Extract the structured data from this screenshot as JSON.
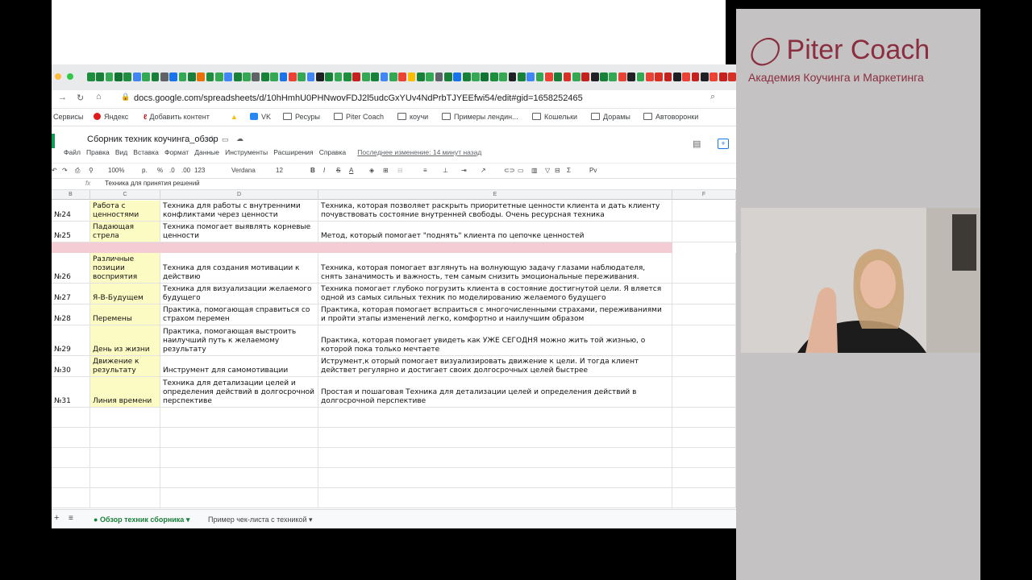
{
  "browser": {
    "url": "docs.google.com/spreadsheets/d/10hHmhU0PHNwovFDJ2l5udcGxYUv4NdPrbTJYEEfwi54/edit#gid=1658252465",
    "bookmarks": [
      "Сервисы",
      "Яндекс",
      "Добавить контент",
      "VK",
      "Ресуры",
      "Piter Coach",
      "коучи",
      "Примеры лендин...",
      "Кошельки",
      "Дорамы",
      "Автоворонки"
    ],
    "favicon_colors": [
      "#1e8e3e",
      "#188038",
      "#34a853",
      "#137333",
      "#1e8e3e",
      "#4285f4",
      "#34a853",
      "#188038",
      "#5f6368",
      "#1a73e8",
      "#34a853",
      "#188038",
      "#e8710a",
      "#1e8e3e",
      "#34a853",
      "#4285f4",
      "#188038",
      "#34a853",
      "#5f6368",
      "#188038",
      "#34a853",
      "#1a73e8",
      "#ea4335",
      "#34a853",
      "#4285f4",
      "#202124",
      "#188038",
      "#34a853",
      "#1e8e3e",
      "#c5221f",
      "#34a853",
      "#188038",
      "#4285f4",
      "#34a853",
      "#ea4335",
      "#fbbc04",
      "#188038",
      "#34a853",
      "#5f6368",
      "#188038",
      "#1a73e8",
      "#188038",
      "#34a853",
      "#137333",
      "#1e8e3e",
      "#34a853",
      "#202124",
      "#188038",
      "#4285f4",
      "#34a853",
      "#ea4335",
      "#188038",
      "#d93025",
      "#34a853",
      "#c5221f",
      "#202124",
      "#188038",
      "#34a853",
      "#ea4335",
      "#202124",
      "#34a853",
      "#ea4335",
      "#d93025",
      "#c5221f",
      "#202124",
      "#ea4335",
      "#c5221f",
      "#202124",
      "#ea4335",
      "#c5221f",
      "#d93025"
    ]
  },
  "doc": {
    "title": "Сборник техник коучинга_обзор",
    "menu": [
      "Файл",
      "Правка",
      "Вид",
      "Вставка",
      "Формат",
      "Данные",
      "Инструменты",
      "Расширения",
      "Справка"
    ],
    "last_edit": "Последнее изменение: 14 минут назад"
  },
  "toolbar": {
    "zoom": "100%",
    "currency": "р.",
    "percent": "%",
    "dec1": ".0",
    "dec2": ".00",
    "numfmt": "123",
    "font": "Verdana",
    "size": "12",
    "bold": "B",
    "italic": "I",
    "strike": "S",
    "textcolor": "A",
    "func": "Σ",
    "input": "Pv"
  },
  "formula_bar": {
    "fx": "fx",
    "value": "Техника для принятия решений"
  },
  "columns": [
    "B",
    "C",
    "D",
    "E",
    "F"
  ],
  "rows": [
    {
      "num": "№24",
      "name": "Работа с\nценностями",
      "desc": "Техника для работы с внутренними\nконфликтами через ценности",
      "detail": "Техника, которая позволяет раскрыть приоритетные ценности клиента и дать клиенту\nпочувствовать состояние внутренней свободы. Очень ресурсная техника"
    },
    {
      "num": "№25",
      "name": "Падающая\nстрела",
      "desc": "Техника помогает выявлять корневые\nценности",
      "detail": "Метод, который помогает \"поднять\" клиента по цепочке ценностей"
    },
    {
      "num": "№26",
      "name": "Различные\nпозиции\nвосприятия",
      "desc": "Техника для создания мотивации к\nдействию",
      "detail": "Техника, которая помогает взглянуть на волнующую задачу глазами наблюдателя,\nснять заначимость и важность, тем самым снизить эмоциональные переживания."
    },
    {
      "num": "№27",
      "name": "Я-В-Будущем",
      "desc": "Техника для визуализации желаемого\nбудущего",
      "detail": "Техника помогает глубоко погрузить клиента в состояние достигнутой цели. Я вляется\nодной из самых сильных техник по моделированию желаемого будущего"
    },
    {
      "num": "№28",
      "name": "Перемены",
      "desc": "Практика, помогающая справиться со\nстрахом перемен",
      "detail": "Практика, которая помогает вспраиться с многочисленными страхами, переживаниями\nи пройти этапы изменений легко, комфортно и наилучшим образом"
    },
    {
      "num": "№29",
      "name": "День из жизни",
      "desc": "Практика, помогающая выстроить\nнаилучший путь к желаемому\nрезультату",
      "detail": "Практика, которая помогает увидеть как УЖЕ СЕГОДНЯ можно жить той жизнью, о\nкоторой пока только мечтаете"
    },
    {
      "num": "№30",
      "name": "Движение к\nрезультату",
      "desc": "Инструмент для самомотивации",
      "detail": "Иструмент,к оторый помогает визуализировать движение к цели. И тогда клиент\nдействет регулярно и достигает своих долгосрочных целей быстрее"
    },
    {
      "num": "№31",
      "name": "Линия времени",
      "desc": "Техника для детализации целей и\nопределения действий в долгосрочной\nперспективе",
      "detail": "Простая и пошаговая Техника для детализации целей и определения действий в\nдолгосрочной перспективе"
    }
  ],
  "sheet_tabs": [
    "Обзор техник сборника",
    "Пример чек-листа с техникой"
  ],
  "brand": {
    "name": "Piter Coach",
    "tagline": "Академия Коучинга и Маркетинга",
    "color": "#8a2e40"
  }
}
